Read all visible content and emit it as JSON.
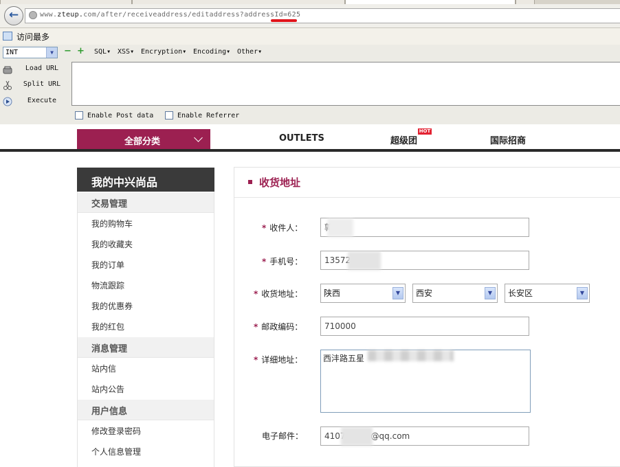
{
  "browser": {
    "url_prefix": "www.",
    "url_host": "zteup.",
    "url_host_rest": "com",
    "url_path": "/after/receiveaddress/editaddress?addressId=625",
    "bookmark_label": "访问最多"
  },
  "hackbar": {
    "type_value": "INT",
    "menus": [
      "SQL",
      "XSS",
      "Encryption",
      "Encoding",
      "Other"
    ],
    "actions": {
      "load": "Load URL",
      "split": "Split URL",
      "execute": "Execute"
    },
    "post_label": "Enable Post data",
    "referrer_label": "Enable Referrer"
  },
  "nav": {
    "all_categories": "全部分类",
    "outlets": "OUTLETS",
    "super_group": "超级团",
    "hot_badge": "HOT",
    "intl": "国际招商"
  },
  "sidebar": {
    "title": "我的中兴尚品",
    "sections": [
      {
        "title": "交易管理",
        "items": [
          "我的购物车",
          "我的收藏夹",
          "我的订单",
          "物流跟踪",
          "我的优惠券",
          "我的红包"
        ]
      },
      {
        "title": "消息管理",
        "items": [
          "站内信",
          "站内公告"
        ]
      },
      {
        "title": "用户信息",
        "items": [
          "修改登录密码",
          "个人信息管理"
        ]
      }
    ]
  },
  "form": {
    "title": "收货地址",
    "required_mark": "*",
    "recipient_label": "收件人：",
    "recipient_value": "郭",
    "phone_label": "手机号：",
    "phone_value": "13572",
    "address_label": "收货地址：",
    "province": "陕西",
    "city": "西安",
    "district": "长安区",
    "zip_label": "邮政编码：",
    "zip_value": "710000",
    "detail_label": "详细地址：",
    "detail_value": "西沣路五星",
    "email_label": "电子邮件：",
    "email_value_prefix": "4107",
    "email_value_suffix": "@qq.com"
  }
}
